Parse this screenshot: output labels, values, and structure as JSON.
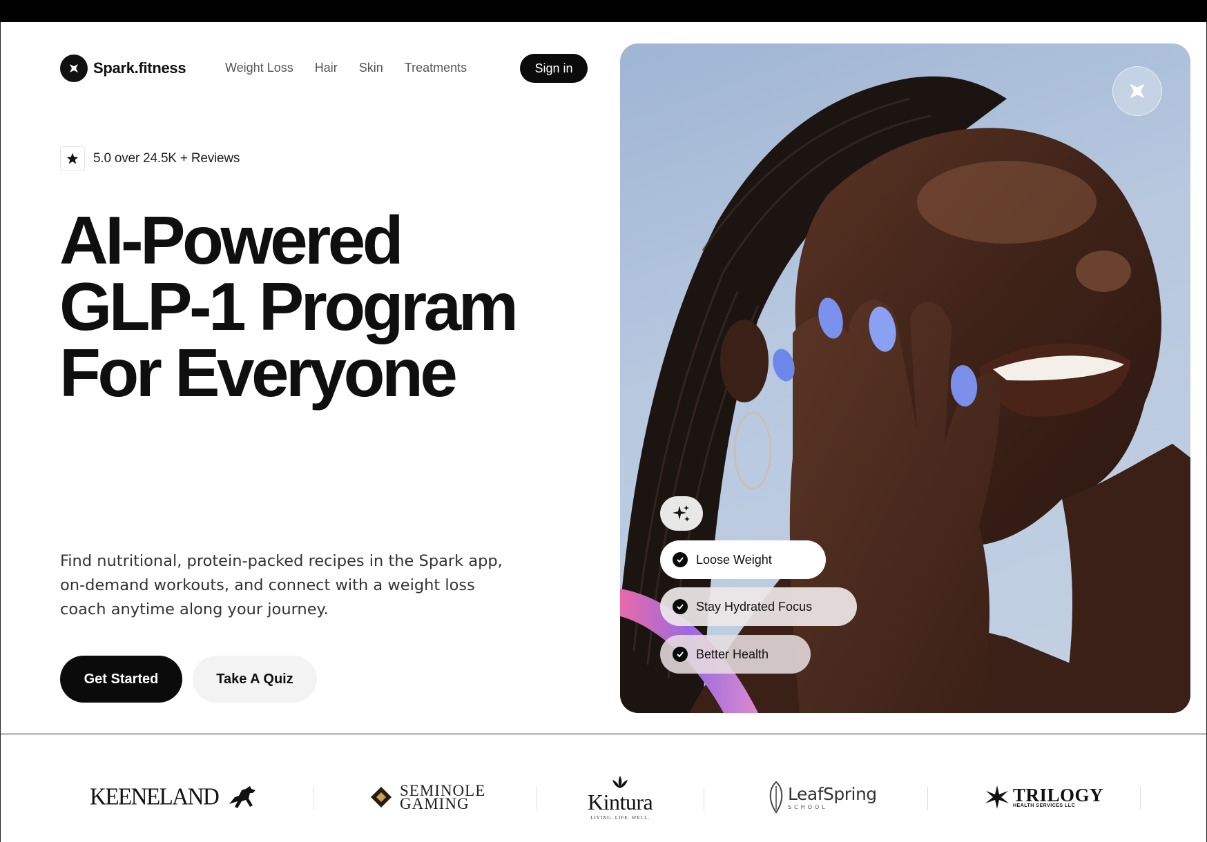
{
  "brand": {
    "name": "Spark.fitness"
  },
  "nav": {
    "links": [
      "Weight Loss",
      "Hair",
      "Skin",
      "Treatments"
    ],
    "sign_in": "Sign in"
  },
  "rating": {
    "text": "5.0 over 24.5K + Reviews"
  },
  "hero": {
    "headline": [
      "AI-Powered",
      "GLP-1 Program",
      "For Everyone"
    ],
    "description": "Find nutritional, protein-packed recipes in the Spark app, on-demand workouts, and connect with a weight loss coach anytime along your journey.",
    "primary_cta": "Get Started",
    "secondary_cta": "Take A Quiz",
    "chips": [
      "Loose Weight",
      "Stay Hydrated Focus",
      "Better Health"
    ]
  },
  "logos": {
    "keeneland": "KEENELAND",
    "seminole": [
      "SEMINOLE",
      "GAMING"
    ],
    "kintura": "Kintura",
    "kintura_tagline": "LIVING. LIFE. WELL.",
    "leafspring": "LeafSpring",
    "leafspring_sub": "SCHOOL",
    "trilogy": "TRILOGY",
    "trilogy_sub": "HEALTH SERVICES LLC"
  },
  "colors": {
    "primary": "#0b0b0b",
    "secondary_bg": "#f3f3f3",
    "sky": "#b7c8df"
  }
}
